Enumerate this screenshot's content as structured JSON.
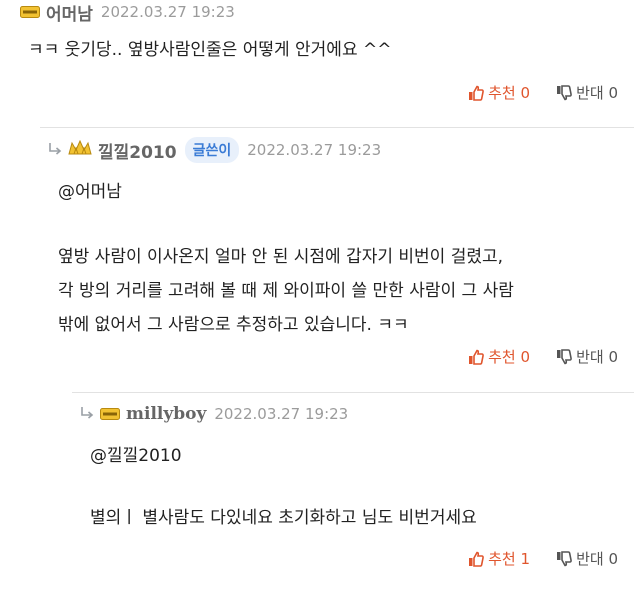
{
  "comments": [
    {
      "nickname": "어머남",
      "date": "2022.03.27 19:23",
      "lines": [
        "ㅋㅋ 웃기당.. 옆방사람인줄은 어떻게 안거에요 ^^"
      ],
      "recommend_label": "추천",
      "recommend_count": "0",
      "oppose_label": "반대",
      "oppose_count": "0"
    },
    {
      "nickname": "낄낄2010",
      "author_badge": "글쓴이",
      "date": "2022.03.27 19:23",
      "mention": "@어머남",
      "lines": [
        "옆방 사람이 이사온지 얼마 안 된 시점에 갑자기 비번이 걸렸고,",
        "각 방의 거리를 고려해 볼 때 제 와이파이 쓸 만한 사람이 그 사람",
        "밖에 없어서 그 사람으로 추정하고 있습니다.  ㅋㅋ"
      ],
      "recommend_label": "추천",
      "recommend_count": "0",
      "oppose_label": "반대",
      "oppose_count": "0"
    },
    {
      "nickname": "millyboy",
      "date": "2022.03.27 19:23",
      "mention": "@낄낄2010",
      "lines": [
        "별의ㅣ  별사람도 다있네요 초기화하고 님도 비번거세요"
      ],
      "recommend_label": "추천",
      "recommend_count": "1",
      "oppose_label": "반대",
      "oppose_count": "0"
    }
  ],
  "icons": {
    "reply": "reply-arrow-icon",
    "grade_bar": "grade-bar-icon",
    "grade_crown": "grade-crown-icon",
    "recommend": "thumbs-up-icon",
    "oppose": "thumbs-down-icon"
  },
  "colors": {
    "recommend": "#e0552d",
    "author_badge": "#3a7bd5",
    "date": "#9b9b9b"
  }
}
